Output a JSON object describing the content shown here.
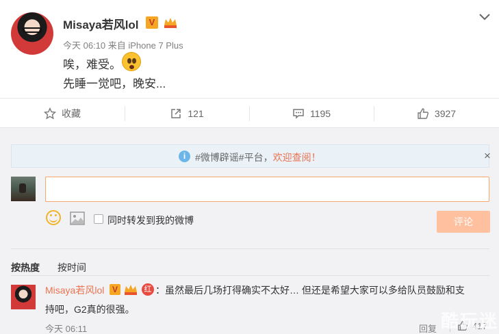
{
  "post": {
    "username": "Misaya若风lol",
    "v_badge": "V",
    "meta": "今天 06:10 来自 iPhone 7 Plus",
    "line1": "唉，难受。",
    "line2": "先睡一觉吧，晚安..."
  },
  "actions": {
    "favorite_label": "收藏",
    "repost_count": "121",
    "comment_count": "1195",
    "like_count": "3927"
  },
  "notice": {
    "prefix": "#微博辟谣#平台，",
    "link": "欢迎查阅！",
    "close": "×"
  },
  "composer": {
    "input_value": "",
    "checkbox_label": "同时转发到我的微博",
    "submit_label": "评论"
  },
  "sort": {
    "hot": "按热度",
    "time": "按时间"
  },
  "comment": {
    "name": "Misaya若风lol",
    "v_badge": "V",
    "red_badge": "红",
    "text_line1": "：虽然最后几场打得确实不太好… 但还是希望大家可以多给队员鼓励和支",
    "text_line2": "持吧，G2真的很强。",
    "time": "今天 06:11",
    "reply_label": "回复",
    "like_count": "417"
  },
  "watermark": "酷玩迷",
  "colors": {
    "accent": "#eb7350",
    "submit_bg": "#ffc09f",
    "page_bg": "#f2f2f5"
  }
}
